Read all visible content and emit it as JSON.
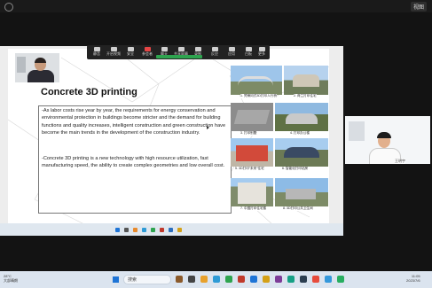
{
  "top_bar": {
    "view_label": "视图"
  },
  "meeting_controls": [
    {
      "label": "静音",
      "icon": "microphone-icon"
    },
    {
      "label": "开启视频",
      "icon": "camera-icon"
    },
    {
      "label": "安全",
      "icon": "shield-icon"
    },
    {
      "label": "参会者",
      "icon": "participants-icon"
    },
    {
      "label": "聊天",
      "icon": "chat-icon"
    },
    {
      "label": "共享屏幕",
      "icon": "share-screen-icon"
    },
    {
      "label": "录制",
      "icon": "record-icon"
    },
    {
      "label": "反应",
      "icon": "reaction-icon"
    },
    {
      "label": "应用",
      "icon": "apps-icon"
    },
    {
      "label": "白板",
      "icon": "whiteboard-icon"
    },
    {
      "label": "更多",
      "icon": "more-icon"
    }
  ],
  "slide": {
    "title": "Concrete 3D printing",
    "paragraph1": "-As labor costs rise year by year, the requirements for energy conservation and environmental protection in buildings become stricter and the demand for building functions and quality increases, intelligent construction and green construction have become the main trends in the development of the construction industry.",
    "paragraph2": "-Concrete 3D printing is a new technology with high resource utilization, fast manufacturing speed, the ability to create complex geometries and low overall cost.",
    "captions": [
      "1. 梵蒂冈式3D打印人行桥",
      "2. 荷兰打印住宅",
      "3. 打印别墅",
      "4. 打印办公楼",
      "5. 3D打印\"未来\"住宅",
      "6. 智能化打印站房",
      "7. 中国打印住宅楼",
      "8. 3D打印公共卫生间"
    ]
  },
  "participant": {
    "name": "王明宇"
  },
  "taskbar": {
    "weather_temp": "28°C",
    "weather_desc": "大部晴朗",
    "search_placeholder": "搜索",
    "time": "11:05",
    "date": "2023/7/6"
  }
}
